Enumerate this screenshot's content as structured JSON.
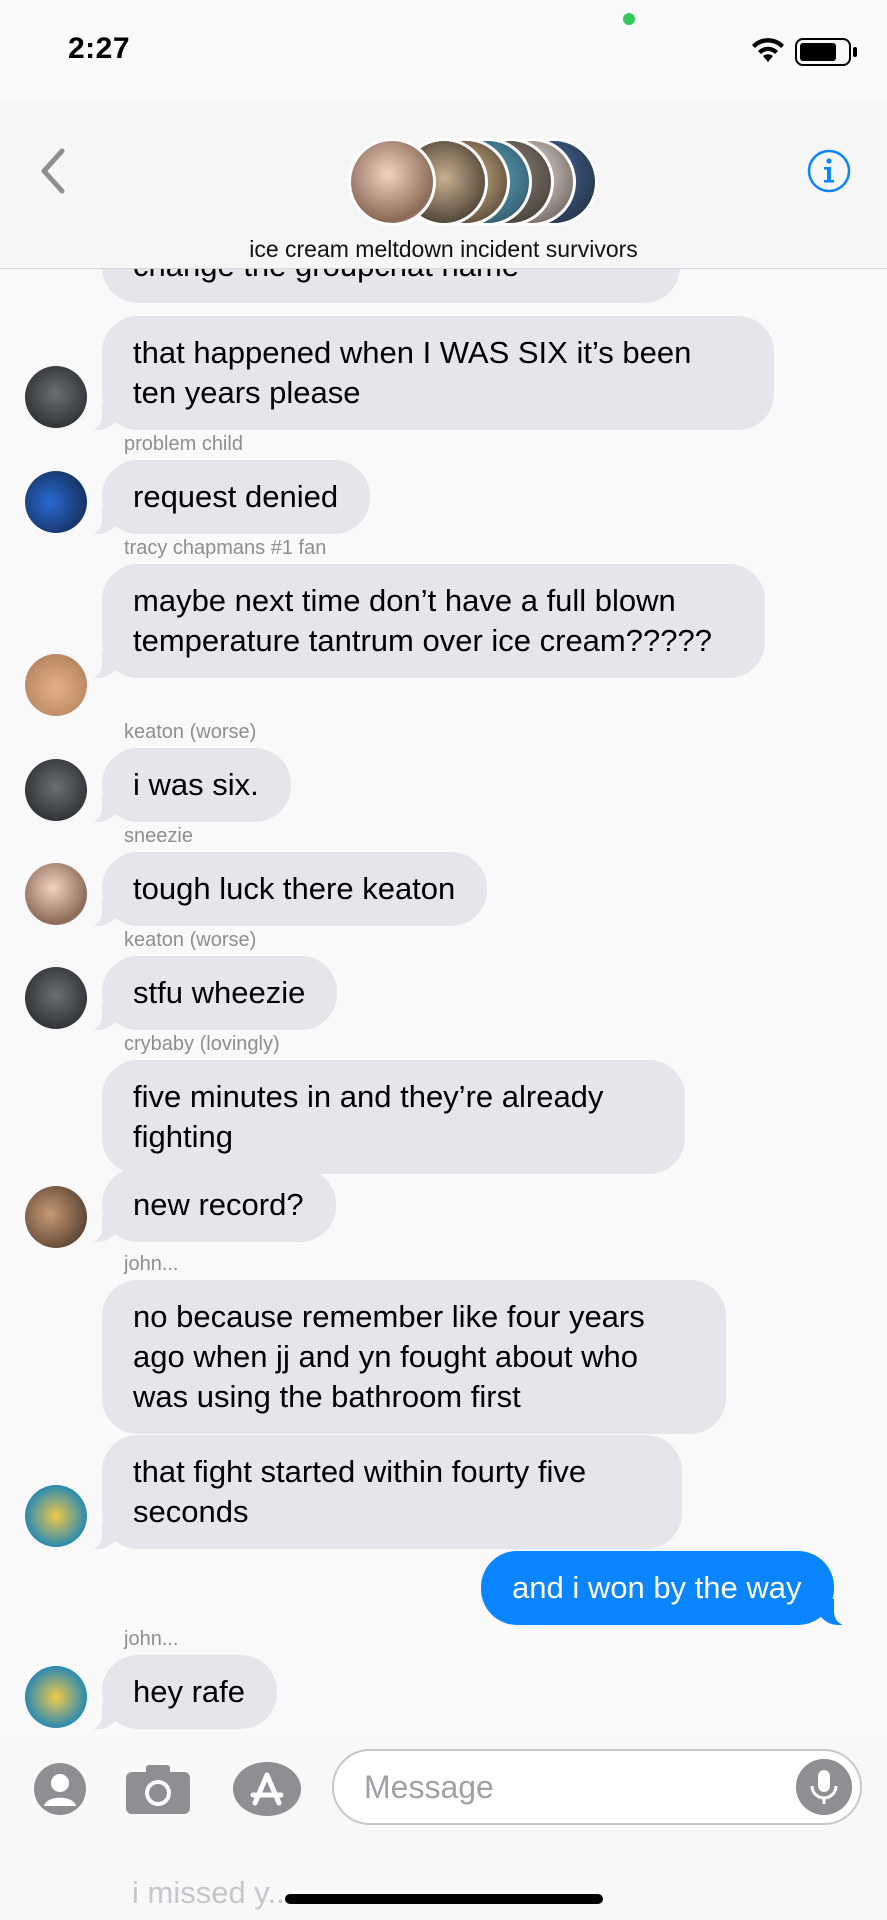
{
  "status": {
    "time": "2:27"
  },
  "header": {
    "group_name": "ice cream meltdown incident survivors"
  },
  "conversation": {
    "partial_top": "change the groupchat name",
    "messages": [
      {
        "text": "that happened when I WAS SIX it’s been ten years please"
      },
      {
        "sender": "problem child",
        "text": "request denied"
      },
      {
        "sender": "tracy chapmans #1 fan",
        "text": "maybe next time don’t have a full blown temperature tantrum over ice cream?????"
      },
      {
        "sender": "keaton (worse)",
        "text": "i was six."
      },
      {
        "sender": "sneezie",
        "text": "tough luck there keaton"
      },
      {
        "sender": "keaton (worse)",
        "text": "stfu wheezie"
      },
      {
        "sender": "crybaby (lovingly)",
        "text": "five minutes in and they’re already fighting"
      },
      {
        "text": "new record?"
      },
      {
        "sender": "john...",
        "text": "no because remember like four years ago when jj and yn fought about who was using the bathroom first"
      },
      {
        "text": "that fight started within fourty five seconds"
      },
      {
        "text": "and i won by the way",
        "outgoing": true
      },
      {
        "sender": "john...",
        "text": "hey rafe"
      }
    ]
  },
  "input": {
    "placeholder": "Message",
    "ghost_below": "i missed y..."
  },
  "colors": {
    "accent": "#0a84ff",
    "incoming_bubble": "#e6e5eb",
    "status_dot": "#34c759"
  },
  "icons": [
    "back-chevron-icon",
    "info-icon",
    "wifi-icon",
    "battery-icon",
    "contact-icon",
    "camera-icon",
    "app-store-icon",
    "microphone-icon"
  ]
}
